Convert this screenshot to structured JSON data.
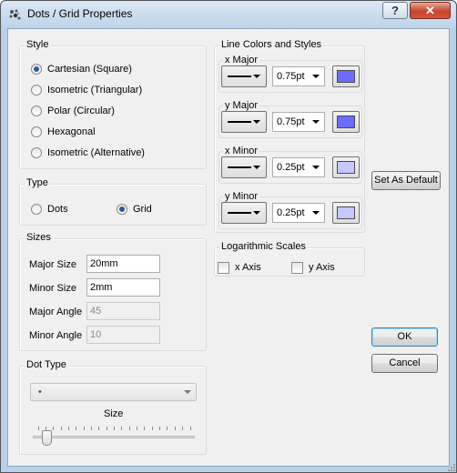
{
  "window": {
    "title": "Dots / Grid Properties",
    "help_label": "?",
    "close_label": "✕"
  },
  "style_group": {
    "title": "Style",
    "options": [
      {
        "label": "Cartesian (Square)",
        "selected": true
      },
      {
        "label": "Isometric (Triangular)",
        "selected": false
      },
      {
        "label": "Polar (Circular)",
        "selected": false
      },
      {
        "label": "Hexagonal",
        "selected": false
      },
      {
        "label": "Isometric (Alternative)",
        "selected": false
      }
    ]
  },
  "type_group": {
    "title": "Type",
    "options": [
      {
        "label": "Dots",
        "selected": false
      },
      {
        "label": "Grid",
        "selected": true
      }
    ]
  },
  "sizes_group": {
    "title": "Sizes",
    "fields": [
      {
        "label": "Major Size",
        "value": "20mm",
        "enabled": true
      },
      {
        "label": "Minor Size",
        "value": "2mm",
        "enabled": true
      },
      {
        "label": "Major Angle",
        "value": "45",
        "enabled": false
      },
      {
        "label": "Minor Angle",
        "value": "10",
        "enabled": false
      }
    ]
  },
  "dot_type_group": {
    "title": "Dot Type",
    "selected": "•",
    "size_label": "Size",
    "size_level": 0.06
  },
  "line_group": {
    "title": "Line Colors and Styles",
    "rows": [
      {
        "label": "x Major",
        "width": "0.75pt",
        "color": "#6b6bff"
      },
      {
        "label": "y Major",
        "width": "0.75pt",
        "color": "#6b6bff"
      },
      {
        "label": "x Minor",
        "width": "0.25pt",
        "color": "#c7c7ff"
      },
      {
        "label": "y Minor",
        "width": "0.25pt",
        "color": "#c7c7ff"
      }
    ]
  },
  "log_group": {
    "title": "Logarithmic Scales",
    "options": [
      {
        "label": "x Axis",
        "checked": false
      },
      {
        "label": "y Axis",
        "checked": false
      }
    ]
  },
  "buttons": {
    "set_default": "Set As Default",
    "ok": "OK",
    "cancel": "Cancel"
  }
}
